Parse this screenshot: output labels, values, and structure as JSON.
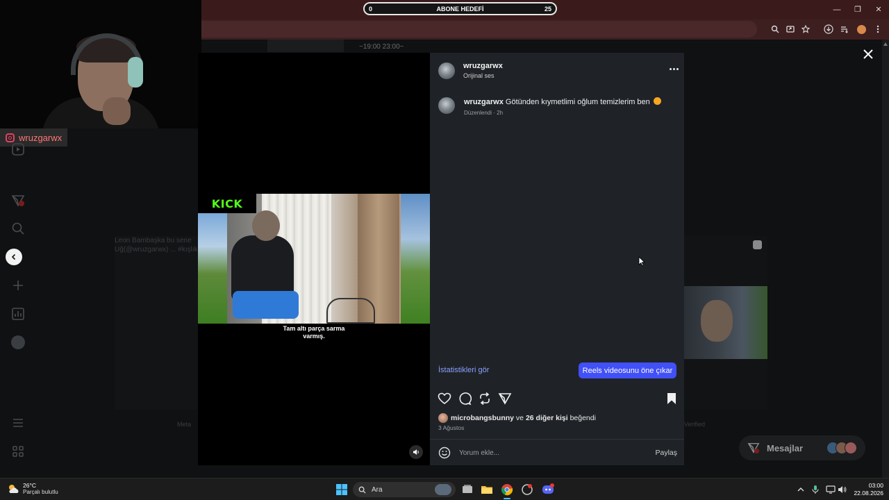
{
  "overlay": {
    "abone_label": "ABONE HEDEFİ",
    "abone_current": "0",
    "abone_target": "25",
    "streamer_handle": "wruzgarwx"
  },
  "background": {
    "time_ghost": "~19:00 23:00~",
    "ghost_post_text": "Leon Bambaşka bu sene Uğ(@wruzgarwx) ... #kışlık",
    "ghost_meta": "Meta",
    "ghost_verified": "Verified",
    "messages_label": "Mesajlar"
  },
  "video": {
    "kick_logo": "KICK",
    "subtitle_line1": "Tam altı parça sarma",
    "subtitle_line2": "varmış."
  },
  "post": {
    "username": "wruzgarwx",
    "audio": "Orijinal ses",
    "caption_user": "wruzgarwx",
    "caption_text": "Götünden kıymetlimi oğlum temizlerim ben",
    "caption_meta": "Düzenlendi · 2h",
    "stats_link": "İstatistikleri gör",
    "boost_button": "Reels videosunu öne çıkar",
    "liked_user": "microbangsbunny",
    "liked_connector": " ve ",
    "liked_others": "26 diğer kişi",
    "liked_suffix": " beğendi",
    "date": "3 Ağustos",
    "comment_placeholder": "Yorum ekle...",
    "share_label": "Paylaş"
  },
  "taskbar": {
    "temperature": "26°C",
    "weather": "Parçalı bulutlu",
    "search_label": "Ara",
    "time": "03:00",
    "date": "22.08.2026"
  },
  "colors": {
    "accent_blue": "#4150f7",
    "link_blue": "#8aa0ff",
    "kick_green": "#53fc18",
    "panel_bg": "#1f2327"
  }
}
